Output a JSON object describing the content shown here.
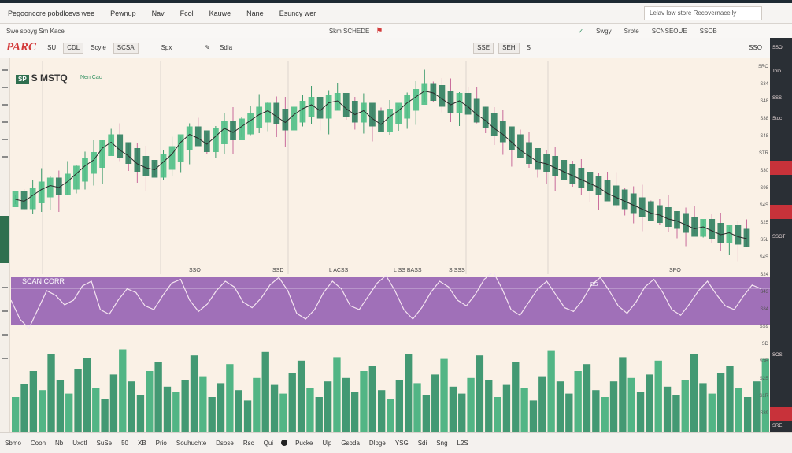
{
  "menubar": {
    "items": [
      "Pegoonccre pobdlcevs wee",
      "Pewnup",
      "Nav",
      "Fcol",
      "Kauwe",
      "Nane",
      "Esuncy wer"
    ],
    "search_text": "Lelav low store Recovernacelly"
  },
  "toolbar1": {
    "left": "Swe spoyg Sm Kace",
    "center": "Skm SCHEDE",
    "right_items": [
      "Swgy",
      "Srbte",
      "SCNSEOUE",
      "SSOB"
    ]
  },
  "toolbar2": {
    "logo": "PARC",
    "items": [
      "SU",
      "Scyle",
      "Spx",
      "Sdla",
      "S"
    ],
    "btn_labels": [
      "CDL",
      "SCSA",
      "SSE",
      "SEH"
    ],
    "right": "SSO"
  },
  "chart": {
    "symbol_tag": "SP",
    "title": "S MSTQ",
    "subtitle": "Nen Cac",
    "x_labels": [
      "SSO",
      "SSD",
      "L ACSS",
      "L SS BASS",
      "S SSS",
      "SPO"
    ]
  },
  "oscillator": {
    "label": "SCAN CORR",
    "marker": "BS"
  },
  "right_axis": {
    "ticks": [
      "SRO",
      "S34",
      "S48",
      "S38",
      "S48",
      "STR",
      "S30",
      "S98",
      "S4S",
      "S25",
      "S5L",
      "S4S",
      "S24",
      "S43",
      "S84",
      "SS9",
      "SD",
      "S3B",
      "S2S",
      "S1R",
      "S39"
    ]
  },
  "right_panel": {
    "items": [
      "SSO",
      "Tolo",
      "SSS",
      "Stoc",
      "SSGT",
      "SOS",
      "SRE"
    ]
  },
  "bottombar": {
    "items": [
      "Sbmo",
      "Coon",
      "Nb",
      "Uxotl",
      "SuSe",
      "50",
      "XB",
      "Prio",
      "Souhuchte",
      "Dsose",
      "Rsc",
      "Qui",
      "Pucke",
      "Ulp",
      "Gsoda",
      "Dlpge",
      "YSG",
      "Sdi",
      "Sng",
      "L2S"
    ]
  },
  "chart_data": {
    "type": "candlestick",
    "series": [
      {
        "name": "price",
        "values": [
          60,
          58,
          64,
          70,
          74,
          72,
          78,
          86,
          94,
          100,
          112,
          118,
          110,
          104,
          96,
          92,
          90,
          98,
          106,
          118,
          126,
          122,
          116,
          124,
          132,
          128,
          134,
          140,
          146,
          150,
          144,
          138,
          146,
          152,
          156,
          150,
          158,
          160,
          152,
          146,
          150,
          142,
          136,
          144,
          150,
          158,
          164,
          170,
          168,
          162,
          156,
          160,
          154,
          146,
          140,
          132,
          126,
          118,
          110,
          104,
          98,
          96,
          92,
          88,
          84,
          80,
          76,
          72,
          66,
          62,
          58,
          54,
          50,
          46,
          44,
          40,
          38,
          34,
          30,
          32,
          28,
          24,
          26,
          22,
          20
        ]
      },
      {
        "name": "oscillator",
        "values": [
          50,
          30,
          20,
          40,
          60,
          55,
          45,
          50,
          65,
          70,
          40,
          35,
          50,
          62,
          58,
          44,
          40,
          55,
          68,
          72,
          50,
          38,
          46,
          60,
          70,
          64,
          48,
          42,
          52,
          66,
          74,
          60,
          36,
          30,
          40,
          58,
          70,
          62,
          44,
          40,
          54,
          68,
          76,
          60,
          40,
          30,
          42,
          58,
          70,
          64,
          50,
          44,
          56,
          72,
          80,
          62,
          40,
          34,
          48,
          62,
          70,
          56,
          42,
          38,
          50,
          66,
          74,
          60,
          44,
          36,
          48,
          64,
          72,
          58,
          40,
          34,
          46,
          60,
          70,
          56,
          44,
          40,
          54,
          66,
          62
        ]
      },
      {
        "name": "volume",
        "values": [
          40,
          55,
          70,
          48,
          90,
          60,
          44,
          72,
          85,
          50,
          38,
          66,
          95,
          58,
          42,
          70,
          80,
          52,
          46,
          60,
          88,
          64,
          40,
          56,
          78,
          48,
          36,
          62,
          92,
          54,
          44,
          68,
          82,
          50,
          40,
          58,
          86,
          62,
          46,
          70,
          76,
          48,
          38,
          60,
          90,
          56,
          42,
          66,
          84,
          52,
          44,
          62,
          88,
          60,
          40,
          54,
          80,
          50,
          36,
          64,
          94,
          58,
          44,
          70,
          78,
          48,
          40,
          58,
          86,
          62,
          46,
          66,
          82,
          52,
          42,
          60,
          90,
          56,
          44,
          68,
          76,
          50,
          40,
          58,
          84
        ]
      }
    ]
  }
}
